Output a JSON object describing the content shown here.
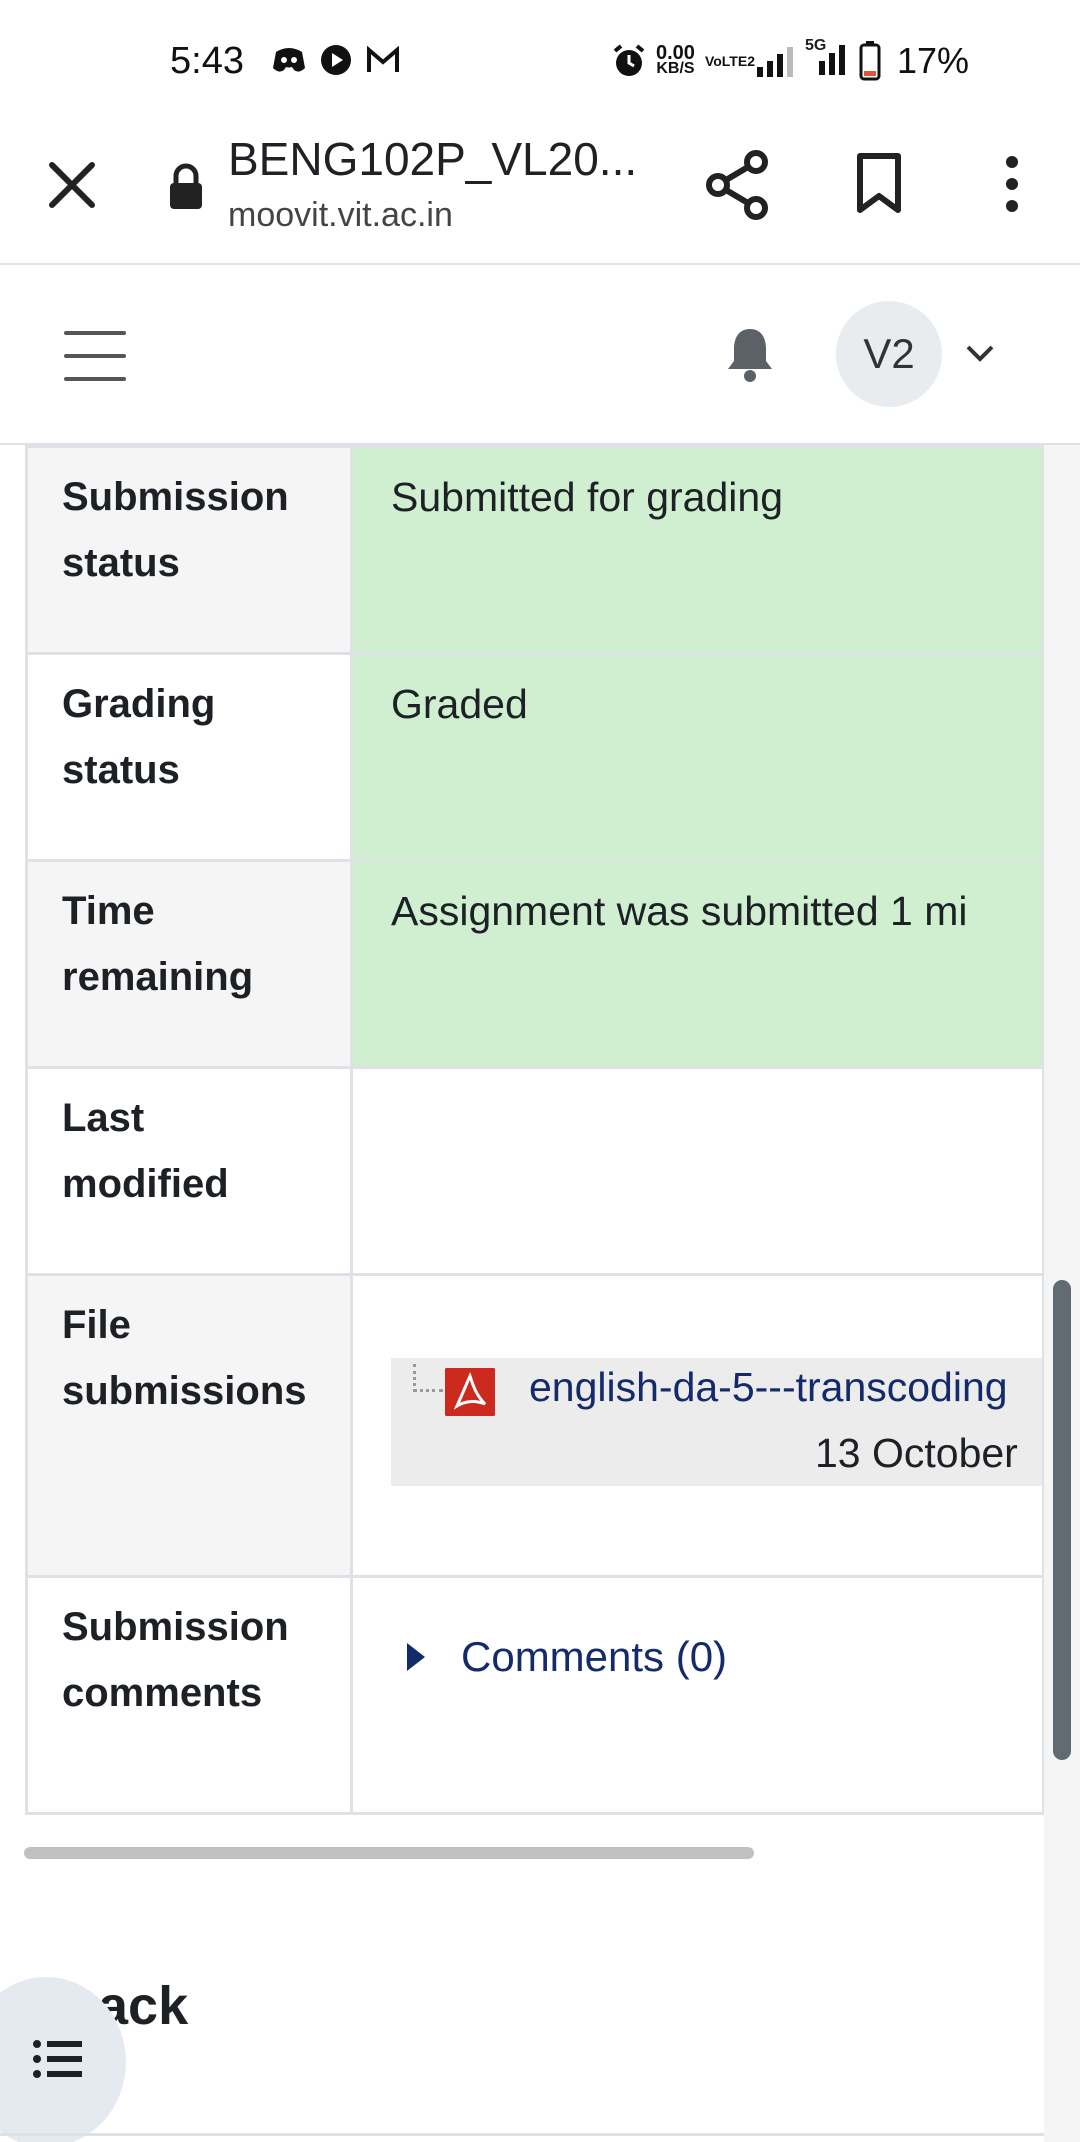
{
  "status_bar": {
    "time": "5:43",
    "net_speed_value": "0.00",
    "net_speed_unit": "KB/S",
    "volte_label": "VoLTE2",
    "network_type": "5G",
    "battery": "17%"
  },
  "browser": {
    "title": "BENG102P_VL20...",
    "url": "moovit.vit.ac.in"
  },
  "header": {
    "avatar_initials": "V2"
  },
  "submission": {
    "rows": [
      {
        "label": "Submission status",
        "value": "Submitted for grading"
      },
      {
        "label": "Grading status",
        "value": "Graded"
      },
      {
        "label": "Time remaining",
        "value": "Assignment was submitted 1 mi"
      },
      {
        "label": "Last modified",
        "value": "[redacted]"
      },
      {
        "label": "File submissions",
        "file_name": "english-da-5---transcoding",
        "file_date": "13 October"
      },
      {
        "label": "Submission comments",
        "comments_link": "Comments (0)"
      }
    ]
  },
  "section": {
    "heading": "edback"
  },
  "colors": {
    "status_green": "#cfefd0",
    "link": "#132a6b",
    "pdf_red": "#cc2a1f"
  }
}
